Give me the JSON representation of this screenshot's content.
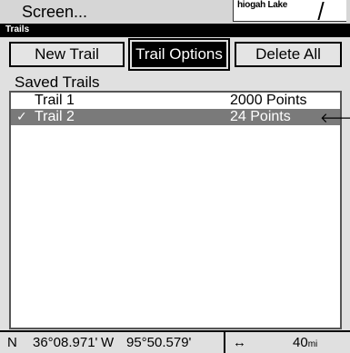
{
  "header": {
    "screen_menu": "Screen...",
    "map_label": "hiogah Lake"
  },
  "title": "Trails",
  "buttons": {
    "new_trail": "New Trail",
    "trail_options": "Trail Options",
    "delete_all": "Delete All"
  },
  "saved_trails": {
    "label": "Saved Trails",
    "items": [
      {
        "name": "Trail 1",
        "points": "2000 Points",
        "selected": false
      },
      {
        "name": "Trail 2",
        "points": "24 Points",
        "selected": true,
        "check": "✓",
        "arrow": "🡐"
      }
    ]
  },
  "status": {
    "lat_dir": "N",
    "lat": "36°08.971'",
    "lon_dir": "W",
    "lon": "95°50.579'",
    "distance_icon": "↔",
    "distance": "40",
    "distance_unit": "mi"
  }
}
